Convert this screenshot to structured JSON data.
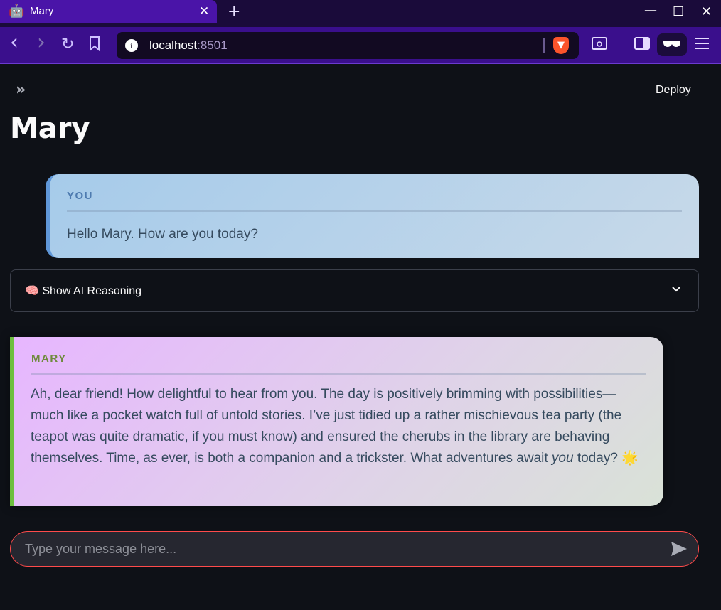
{
  "browser": {
    "tab": {
      "favicon": "🤖",
      "title": "Mary"
    },
    "url": {
      "host": "localhost",
      "port": ":8501"
    },
    "icons": {
      "back": "‹",
      "forward": "›",
      "reload": "↻",
      "bookmark": "bookmark-icon",
      "new_tab": "+",
      "close_tab": "✕",
      "minimize": "—",
      "maximize": "☐",
      "close_window": "✕"
    }
  },
  "app": {
    "sidebar_toggle": "»",
    "deploy_label": "Deploy",
    "title": "Mary",
    "messages": [
      {
        "sender": "YOU",
        "text": "Hello Mary. How are you today?"
      },
      {
        "sender": "MARY",
        "text_before": "Ah, dear friend! How delightful to hear from you. The day is positively brimming with possibilities—much like a pocket watch full of untold stories. I’ve just tidied up a rather mischievous tea party (the teapot was quite dramatic, if you must know) and ensured the cherubs in the library are behaving themselves. Time, as ever, is both a companion and a trickster. What adventures await ",
        "text_emph": "you",
        "text_after": " today? 🌟"
      }
    ],
    "reasoning": {
      "icon": "🧠",
      "label": "Show AI Reasoning",
      "chevron": "⌄"
    },
    "chat_input": {
      "placeholder": "Type your message here...",
      "value": ""
    },
    "colors": {
      "accent": "#ff4b4b",
      "user_border": "#5f97d8",
      "mary_border": "#6dbf3e"
    }
  }
}
